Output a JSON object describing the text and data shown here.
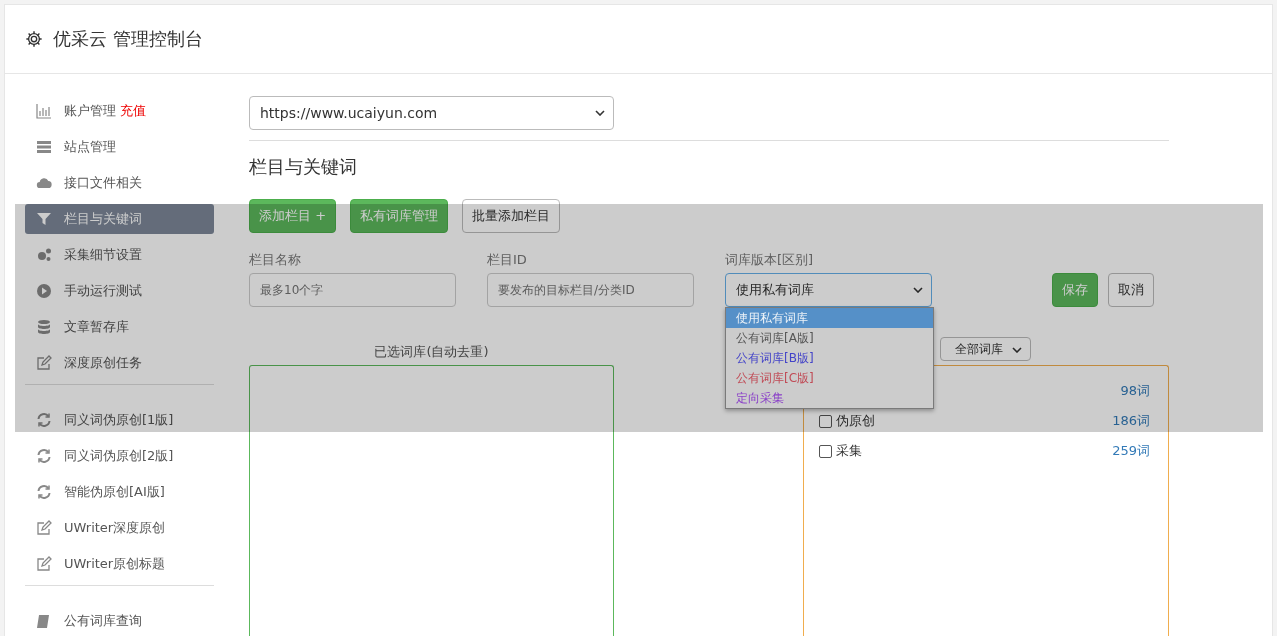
{
  "header": {
    "title": "优采云 管理控制台"
  },
  "sidebar": {
    "groups": [
      {
        "items": [
          {
            "label": "账户管理",
            "badge": "充值",
            "selected": false
          },
          {
            "label": "站点管理",
            "selected": false
          },
          {
            "label": "接口文件相关",
            "selected": false
          },
          {
            "label": "栏目与关键词",
            "selected": true
          },
          {
            "label": "采集细节设置",
            "selected": false
          },
          {
            "label": "手动运行测试",
            "selected": false
          },
          {
            "label": "文章暂存库",
            "selected": false
          },
          {
            "label": "深度原创任务",
            "selected": false
          }
        ]
      },
      {
        "items": [
          {
            "label": "同义词伪原创[1版]",
            "selected": false
          },
          {
            "label": "同义词伪原创[2版]",
            "selected": false
          },
          {
            "label": "智能伪原创[AI版]",
            "selected": false
          },
          {
            "label": "UWriter深度原创",
            "selected": false
          },
          {
            "label": "UWriter原创标题",
            "selected": false
          }
        ]
      },
      {
        "items": [
          {
            "label": "公有词库查询",
            "selected": false
          }
        ]
      }
    ]
  },
  "site_select": {
    "value": "https://www.ucaiyun.com"
  },
  "section_title": "栏目与关键词",
  "toolbar": [
    {
      "label": "添加栏目 +",
      "kind": "primary"
    },
    {
      "label": "私有词库管理",
      "kind": "primary"
    },
    {
      "label": "批量添加栏目",
      "kind": "default"
    }
  ],
  "form": {
    "name_field": {
      "label": "栏目名称",
      "placeholder": "最多10个字"
    },
    "id_field": {
      "label": "栏目ID",
      "placeholder": "要发布的目标栏目/分类ID"
    },
    "version_select": {
      "label": "词库版本[区别]",
      "value": "使用私有词库",
      "expanded": true,
      "options": [
        {
          "label": "使用私有词库",
          "selected": true
        },
        {
          "label": "公有词库[A版]",
          "selected": false,
          "color": "#555555"
        },
        {
          "label": "公有词库[B版]",
          "selected": false,
          "color": "#4343c8"
        },
        {
          "label": "公有词库[C版]",
          "selected": false,
          "color": "#c04a55"
        },
        {
          "label": "定向采集",
          "selected": false,
          "color": "#8a40c8"
        }
      ]
    },
    "save_button": "保存",
    "cancel_button": "取消"
  },
  "selected_libraries": {
    "title": "已选词库(自动去重)"
  },
  "library_filter": {
    "value": "全部词库"
  },
  "libraries": [
    {
      "count": "98词"
    },
    {
      "label": "伪原创",
      "count": "186词",
      "checked": false
    },
    {
      "label": "采集",
      "count": "259词",
      "checked": false
    }
  ]
}
